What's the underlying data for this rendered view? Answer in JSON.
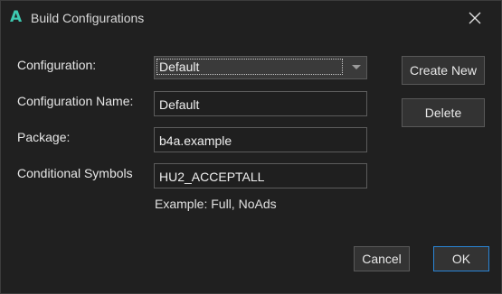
{
  "window": {
    "title": "Build Configurations",
    "app_icon_glyph": "A",
    "accent_color": "#3dc9b0"
  },
  "form": {
    "configuration_label": "Configuration:",
    "configuration_value": "Default",
    "configuration_name_label": "Configuration Name:",
    "configuration_name_value": "Default",
    "package_label": "Package:",
    "package_value": "b4a.example",
    "conditional_symbols_label": "Conditional Symbols",
    "conditional_symbols_value": "HU2_ACCEPTALL",
    "example_hint": "Example: Full, NoAds"
  },
  "buttons": {
    "create_new": "Create New",
    "delete": "Delete",
    "cancel": "Cancel",
    "ok": "OK"
  }
}
